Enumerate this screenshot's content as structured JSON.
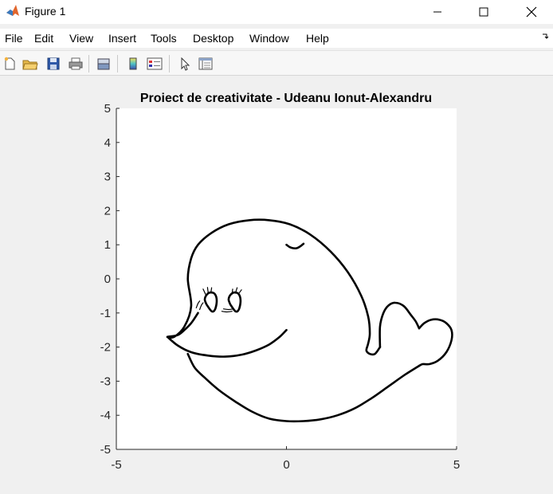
{
  "window": {
    "title": "Figure 1",
    "minimize_icon": "minimize-icon",
    "maximize_icon": "maximize-icon",
    "close_icon": "close-icon"
  },
  "menu": {
    "items": [
      "File",
      "Edit",
      "View",
      "Insert",
      "Tools",
      "Desktop",
      "Window",
      "Help"
    ],
    "dock_icon": "dock-arrow-icon"
  },
  "toolbar": {
    "icons": [
      "new-figure-icon",
      "open-file-icon",
      "save-icon",
      "print-icon",
      "link-icon",
      "colorbar-icon",
      "legend-icon",
      "edit-plot-icon",
      "property-inspector-icon"
    ]
  },
  "chart_data": {
    "type": "line",
    "title": "Proiect de creativitate - Udeanu Ionut-Alexandru",
    "xlabel": "",
    "ylabel": "",
    "xlim": [
      -5,
      5
    ],
    "ylim": [
      -5,
      5
    ],
    "x_ticks": [
      "-5",
      "0",
      "5"
    ],
    "y_ticks": [
      "5",
      "4",
      "3",
      "2",
      "1",
      "0",
      "-1",
      "-2",
      "-3",
      "-4",
      "-5"
    ],
    "grid": false,
    "line_color": "#000000",
    "axes_background": "#ffffff",
    "series": [
      {
        "part": "body-outline",
        "x": [
          -2.6,
          -2.8,
          -3.0,
          -3.2,
          -3.5,
          -3.3,
          -3.0,
          -2.8,
          -2.9,
          -2.8,
          -2.6,
          -2.2,
          -1.7,
          -1.1,
          -0.5,
          0.1,
          0.7,
          1.3,
          1.8,
          2.2,
          2.4,
          2.45,
          2.4,
          2.35,
          2.45,
          2.6,
          2.75
        ],
        "y": [
          -1.0,
          -1.3,
          -1.5,
          -1.65,
          -1.7,
          -1.7,
          -1.4,
          -0.8,
          0.0,
          0.6,
          1.0,
          1.35,
          1.6,
          1.72,
          1.72,
          1.6,
          1.3,
          0.8,
          0.2,
          -0.5,
          -1.1,
          -1.6,
          -1.9,
          -2.1,
          -2.2,
          -2.2,
          -2.0
        ]
      },
      {
        "part": "upper-fin",
        "x": [
          2.75,
          2.75,
          2.85,
          3.0,
          3.2,
          3.45,
          3.65,
          3.8,
          3.9
        ],
        "y": [
          -2.0,
          -1.4,
          -1.0,
          -0.78,
          -0.7,
          -0.8,
          -1.05,
          -1.25,
          -1.45
        ]
      },
      {
        "part": "tail-fin",
        "x": [
          3.9,
          4.05,
          4.25,
          4.5,
          4.7,
          4.85,
          4.85,
          4.7,
          4.45,
          4.2,
          4.0,
          3.9
        ],
        "y": [
          -1.45,
          -1.3,
          -1.2,
          -1.2,
          -1.3,
          -1.5,
          -1.8,
          -2.15,
          -2.4,
          -2.5,
          -2.5,
          -2.55
        ]
      },
      {
        "part": "belly",
        "x": [
          3.9,
          3.5,
          3.0,
          2.5,
          2.0,
          1.5,
          1.0,
          0.5,
          0.0,
          -0.5,
          -1.0,
          -1.5,
          -2.0,
          -2.4,
          -2.7,
          -2.9
        ],
        "y": [
          -2.55,
          -2.8,
          -3.15,
          -3.5,
          -3.8,
          -4.0,
          -4.12,
          -4.17,
          -4.17,
          -4.1,
          -3.9,
          -3.6,
          -3.25,
          -2.9,
          -2.6,
          -2.2
        ]
      },
      {
        "part": "mouth",
        "x": [
          -3.5,
          -3.2,
          -2.8,
          -2.3,
          -1.8,
          -1.3,
          -0.9,
          -0.5,
          -0.2,
          0.0
        ],
        "y": [
          -1.7,
          -1.95,
          -2.15,
          -2.25,
          -2.28,
          -2.22,
          -2.1,
          -1.92,
          -1.7,
          -1.5
        ]
      },
      {
        "part": "blowhole",
        "x": [
          0.0,
          0.1,
          0.2,
          0.3,
          0.4,
          0.5
        ],
        "y": [
          1.0,
          0.93,
          0.9,
          0.9,
          0.95,
          1.03
        ]
      },
      {
        "part": "left-eye",
        "x": [
          -2.35,
          -2.2,
          -2.1,
          -2.05,
          -2.1,
          -2.22,
          -2.33,
          -2.4,
          -2.35
        ],
        "y": [
          -0.75,
          -0.95,
          -0.9,
          -0.65,
          -0.45,
          -0.4,
          -0.45,
          -0.6,
          -0.75
        ]
      },
      {
        "part": "right-eye",
        "x": [
          -1.65,
          -1.5,
          -1.4,
          -1.35,
          -1.4,
          -1.52,
          -1.63,
          -1.7,
          -1.65
        ],
        "y": [
          -0.75,
          -0.95,
          -0.9,
          -0.65,
          -0.45,
          -0.4,
          -0.45,
          -0.6,
          -0.75
        ]
      },
      {
        "part": "cheek-lines",
        "x": [
          -2.65,
          -2.6,
          -2.55,
          null,
          -2.55,
          -2.5,
          -2.45,
          null,
          -1.85,
          -1.7,
          -1.55,
          null,
          -1.9,
          -1.75,
          -1.6
        ],
        "y": [
          -0.85,
          -0.72,
          -0.65,
          null,
          -0.9,
          -0.77,
          -0.7,
          null,
          -0.88,
          -0.9,
          -0.88,
          null,
          -0.95,
          -0.97,
          -0.95
        ]
      },
      {
        "part": "eyelashes",
        "x": [
          -2.38,
          -2.45,
          null,
          -2.3,
          -2.32,
          null,
          -2.22,
          -2.2,
          null,
          -1.6,
          -1.58,
          null,
          -1.5,
          -1.45,
          null,
          -1.42,
          -1.32
        ],
        "y": [
          -0.45,
          -0.3,
          null,
          -0.42,
          -0.25,
          null,
          -0.4,
          -0.26,
          null,
          -0.45,
          -0.3,
          null,
          -0.42,
          -0.26,
          null,
          -0.45,
          -0.32
        ]
      }
    ]
  }
}
